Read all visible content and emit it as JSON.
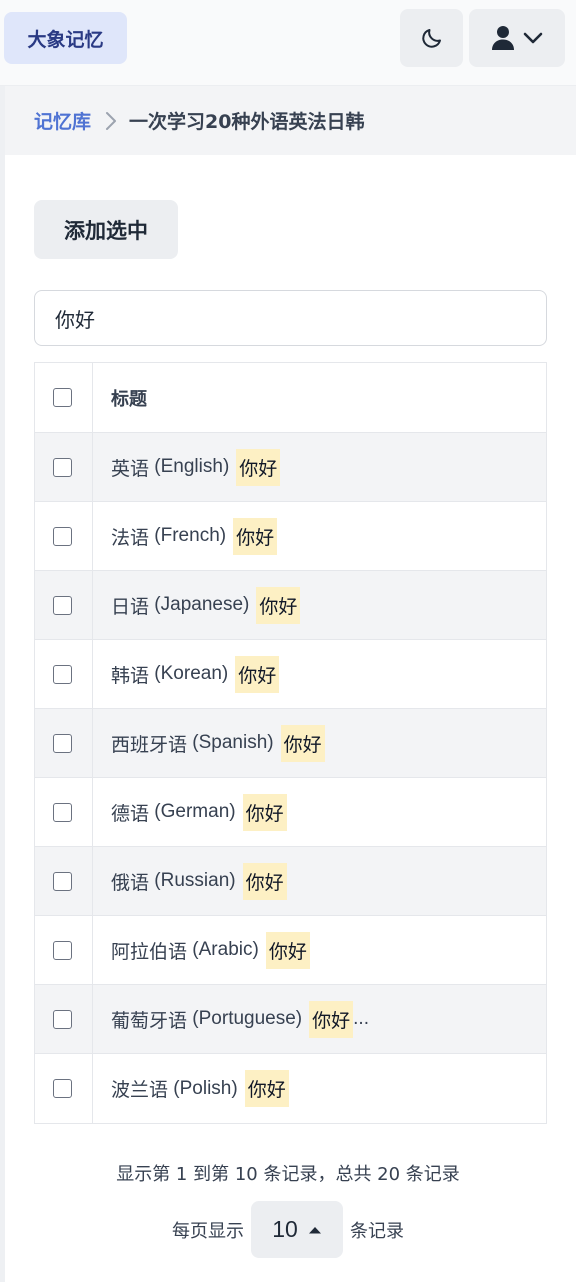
{
  "app": {
    "brand": "大象记忆",
    "icons": {
      "theme": "moon-icon",
      "user": "user-icon",
      "menu": "chevron-down-icon"
    }
  },
  "breadcrumb": {
    "root": "记忆库",
    "current": "一次学习20种外语英法日韩"
  },
  "toolbar": {
    "add_selected": "添加选中"
  },
  "search": {
    "value": "你好"
  },
  "table": {
    "header": {
      "title": "标题"
    },
    "rows": [
      {
        "name": "英语",
        "lang": "(English)",
        "highlight": "你好",
        "suffix": ""
      },
      {
        "name": "法语",
        "lang": "(French)",
        "highlight": "你好",
        "suffix": ""
      },
      {
        "name": "日语",
        "lang": "(Japanese)",
        "highlight": "你好",
        "suffix": ""
      },
      {
        "name": "韩语",
        "lang": "(Korean)",
        "highlight": "你好",
        "suffix": ""
      },
      {
        "name": "西班牙语",
        "lang": "(Spanish)",
        "highlight": "你好",
        "suffix": ""
      },
      {
        "name": "德语",
        "lang": "(German)",
        "highlight": "你好",
        "suffix": ""
      },
      {
        "name": "俄语",
        "lang": "(Russian)",
        "highlight": "你好",
        "suffix": ""
      },
      {
        "name": "阿拉伯语",
        "lang": "(Arabic)",
        "highlight": "你好",
        "suffix": ""
      },
      {
        "name": "葡萄牙语",
        "lang": "(Portuguese)",
        "highlight": "你好",
        "suffix": "..."
      },
      {
        "name": "波兰语",
        "lang": "(Polish)",
        "highlight": "你好",
        "suffix": ""
      }
    ]
  },
  "pagination": {
    "summary": "显示第 1 到第 10 条记录，总共 20 条记录",
    "per_page_prefix": "每页显示",
    "per_page_value": "10",
    "per_page_suffix": "条记录"
  },
  "colors": {
    "brand_bg": "#dfe6fa",
    "brand_text": "#2a3a84",
    "link": "#4f73d3",
    "highlight": "#fdf0c4"
  }
}
